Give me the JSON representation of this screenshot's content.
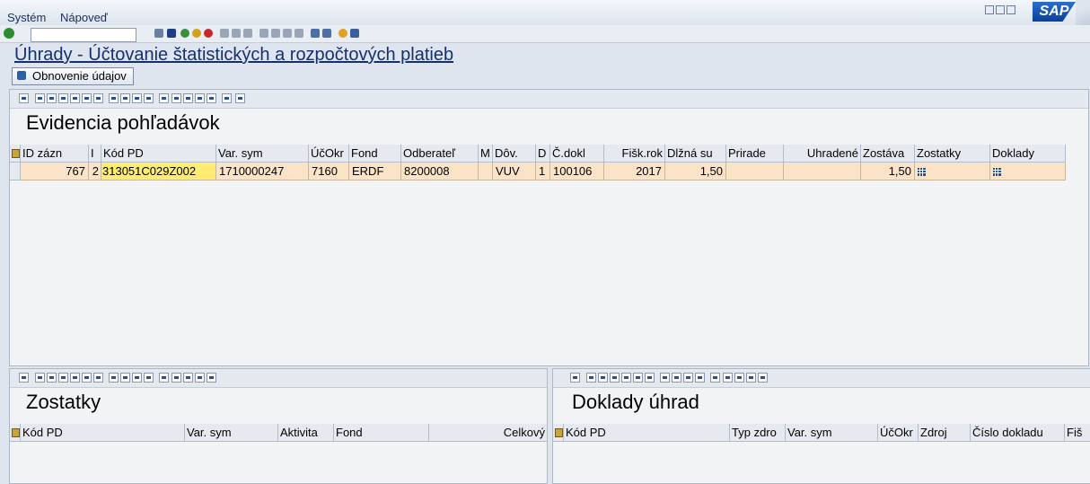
{
  "menu": {
    "system": "Systém",
    "help": "Nápoveď"
  },
  "brand": {
    "logo_text": "SAP"
  },
  "command_field": {
    "value": ""
  },
  "page": {
    "title": "Úhrady - Účtovanie štatistických a rozpočtových platieb",
    "refresh_button": "Obnovenie údajov"
  },
  "main_grid": {
    "title": "Evidencia pohľadávok",
    "columns": [
      "ID zázn",
      "I",
      "Kód PD",
      "Var. sym",
      "ÚčOkr",
      "Fond",
      "Odberateľ",
      "M",
      "Dôv.",
      "D",
      "Č.dokl",
      "Fišk.rok",
      "Dlžná su",
      "Prirade",
      "Uhradené",
      "Zostáva",
      "Zostatky",
      "Doklady"
    ],
    "rows": [
      {
        "id": "767",
        "i": "2",
        "kod_pd": "313051C029Z002",
        "var_sym": "1710000247",
        "ucokr": "7160",
        "fond": "ERDF",
        "odberatel": "8200008",
        "m": "",
        "dov": "VUV",
        "d": "1",
        "c_dokl": "100106",
        "fisk_rok": "2017",
        "dlzna_suma": "1,50",
        "priradene": "",
        "uhradene": "",
        "zostava": "1,50",
        "zostatky_icon": "table-icon",
        "doklady_icon": "table-icon"
      }
    ]
  },
  "bottom_left": {
    "title": "Zostatky",
    "columns": [
      "Kód PD",
      "Var. sym",
      "Aktivita",
      "Fond",
      "Celkový"
    ]
  },
  "bottom_right": {
    "title": "Doklady úhrad",
    "columns": [
      "Kód PD",
      "Typ zdro",
      "Var. sym",
      "ÚčOkr",
      "Zdroj",
      "Číslo dokladu",
      "Fiš"
    ]
  },
  "colors": {
    "row_bg": "#fbe3c8",
    "highlight": "#ffec73",
    "title": "#16306e"
  }
}
